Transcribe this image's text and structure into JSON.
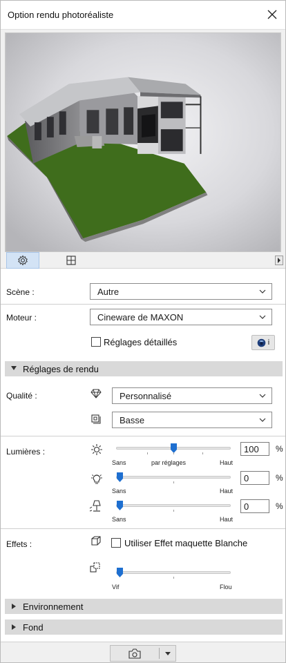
{
  "window": {
    "title": "Option rendu photoréaliste"
  },
  "tabs": [
    {
      "name": "settings",
      "icon": "gear-icon"
    },
    {
      "name": "size",
      "icon": "size-frame-icon"
    }
  ],
  "scene": {
    "label": "Scène :",
    "value": "Autre"
  },
  "engine": {
    "label": "Moteur :",
    "value": "Cineware de MAXON"
  },
  "detailed": {
    "label": "Réglages détaillés",
    "checked": false
  },
  "render_settings": {
    "title": "Réglages de rendu",
    "expanded": true
  },
  "quality": {
    "label": "Qualité :",
    "preset": "Personnalisé",
    "level": "Basse"
  },
  "lights": {
    "label": "Lumières :",
    "sliders": [
      {
        "icon": "sun-icon",
        "value": "100",
        "unit": "%",
        "level": 0.5,
        "labels": [
          "Sans",
          "par réglages",
          "Haut"
        ]
      },
      {
        "icon": "bulb-icon",
        "value": "0",
        "unit": "%",
        "level": 0.0,
        "labels": [
          "Sans",
          "Haut"
        ]
      },
      {
        "icon": "lamp-icon",
        "value": "0",
        "unit": "%",
        "level": 0.0,
        "labels": [
          "Sans",
          "Haut"
        ]
      }
    ]
  },
  "effects": {
    "label": "Effets :",
    "white_model": "Utiliser Effet maquette Blanche",
    "white_model_checked": false,
    "slider": {
      "level": 0.0,
      "labels": [
        "Vif",
        "Flou"
      ]
    }
  },
  "environment": {
    "title": "Environnement",
    "expanded": false
  },
  "background": {
    "title": "Fond",
    "expanded": false
  },
  "colors": {
    "panel": "#ffffff",
    "section": "#d9d9d9",
    "thumb": "#1e6fd0",
    "grass": "#3f6d1c"
  }
}
